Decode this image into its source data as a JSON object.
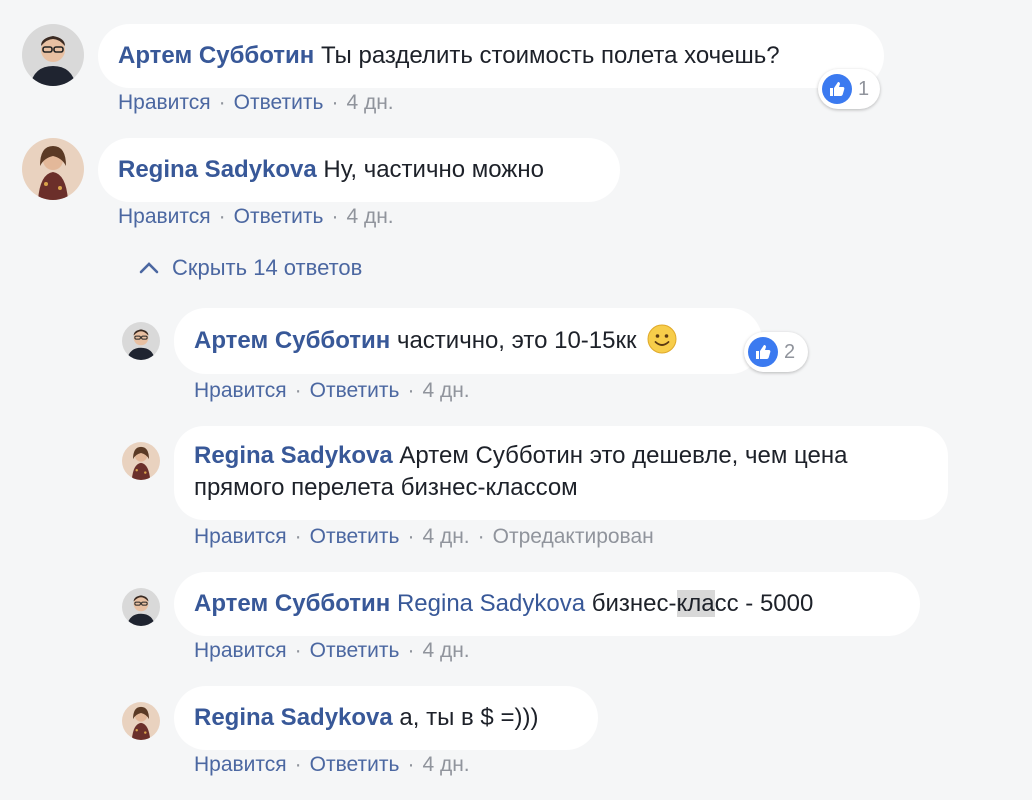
{
  "comments": [
    {
      "author": "Артем Субботин",
      "text": "Ты разделить стоимость полета хочешь?",
      "like_action": "Нравится",
      "reply_action": "Ответить",
      "time": "4 дн.",
      "reaction_count": "1"
    },
    {
      "author": "Regina Sadykova",
      "text": "Ну, частично можно",
      "like_action": "Нравится",
      "reply_action": "Ответить",
      "time": "4 дн."
    }
  ],
  "replies_toggle": {
    "label": "Скрыть 14 ответов"
  },
  "replies": [
    {
      "author": "Артем Субботин",
      "text": "частично, это 10-15кк",
      "emoji": "smile-emoji",
      "like_action": "Нравится",
      "reply_action": "Ответить",
      "time": "4 дн.",
      "reaction_count": "2"
    },
    {
      "author": "Regina Sadykova",
      "text_line1": "Артем Субботин это дешевле, чем цена",
      "text_line2": "прямого перелета бизнес-классом",
      "like_action": "Нравится",
      "reply_action": "Ответить",
      "time": "4 дн.",
      "edited": "Отредактирован"
    },
    {
      "author": "Артем Субботин",
      "mention": "Regina Sadykova",
      "text_pre": "бизнес-",
      "text_hl": "кла",
      "text_post": "сс - 5000",
      "like_action": "Нравится",
      "reply_action": "Ответить",
      "time": "4 дн."
    },
    {
      "author": "Regina Sadykova",
      "text": "а, ты в $ =)))",
      "like_action": "Нравится",
      "reply_action": "Ответить",
      "time": "4 дн."
    }
  ],
  "colors": {
    "background": "#f5f6f7",
    "author_link": "#385898",
    "action_link": "#4b67a1",
    "meta_gray": "#90949c",
    "like_blue": "#3b7af0"
  }
}
